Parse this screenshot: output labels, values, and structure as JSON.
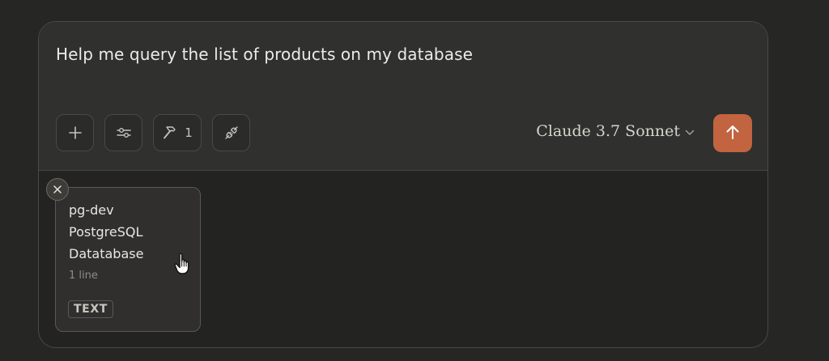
{
  "composer": {
    "prompt_text": "Help me query the list of products on my database"
  },
  "toolbar": {
    "add_icon": "plus-icon",
    "settings_icon": "sliders-icon",
    "tools_icon": "hammer-icon",
    "tools_count": "1",
    "connect_icon": "plug-icon"
  },
  "model_selector": {
    "label": "Claude 3.7 Sonnet",
    "icon": "chevron-down-icon"
  },
  "send_button": {
    "icon": "arrow-up-icon",
    "color": "#c2643f"
  },
  "attachment": {
    "lines": [
      "pg-dev",
      "PostgreSQL",
      "Datatabase"
    ],
    "meta": "1 line",
    "badge": "TEXT",
    "remove_icon": "close-icon"
  }
}
